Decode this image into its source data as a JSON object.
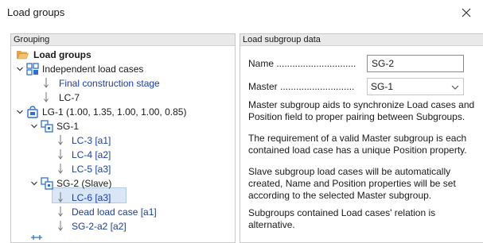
{
  "window": {
    "title": "Load groups"
  },
  "left_panel": {
    "header": "Grouping"
  },
  "tree": {
    "root": "Load groups",
    "independent": "Independent load cases",
    "final_stage": "Final construction stage",
    "lc7": "LC-7",
    "lg1": "LG-1 (1.00, 1.35, 1.00, 1.00, 0.85)",
    "sg1": "SG-1",
    "lc3": "LC-3  [a1]",
    "lc4": "LC-4  [a2]",
    "lc5": "LC-5  [a3]",
    "sg2": "SG-2 (Slave)",
    "lc6": "LC-6  [a3]",
    "dead": "Dead load case  [a1]",
    "sg2a2": "SG-2-a2  [a2]"
  },
  "right_panel": {
    "header": "Load subgroup data",
    "name_label": "Name ..............................",
    "name_value": "SG-2",
    "master_label": "Master ............................",
    "master_value": "SG-1",
    "p1": "Master subgroup aids to synchronize Load cases and Position field to proper pairing between Subgroups.",
    "p2": "The requirement of a valid Master subgroup is each contained load case has a unique Position property.",
    "p3": "Slave subgroup load cases will be automatically created, Name and Position properties will be set according to the selected Master subgroup.",
    "p4": "Subgroups contained Load cases' relation is alternative."
  },
  "colors": {
    "link_blue": "#1a3ea8",
    "selection": "#d9e6f5",
    "folder": "#e8a33c",
    "icon_blue": "#2f6fd1"
  }
}
